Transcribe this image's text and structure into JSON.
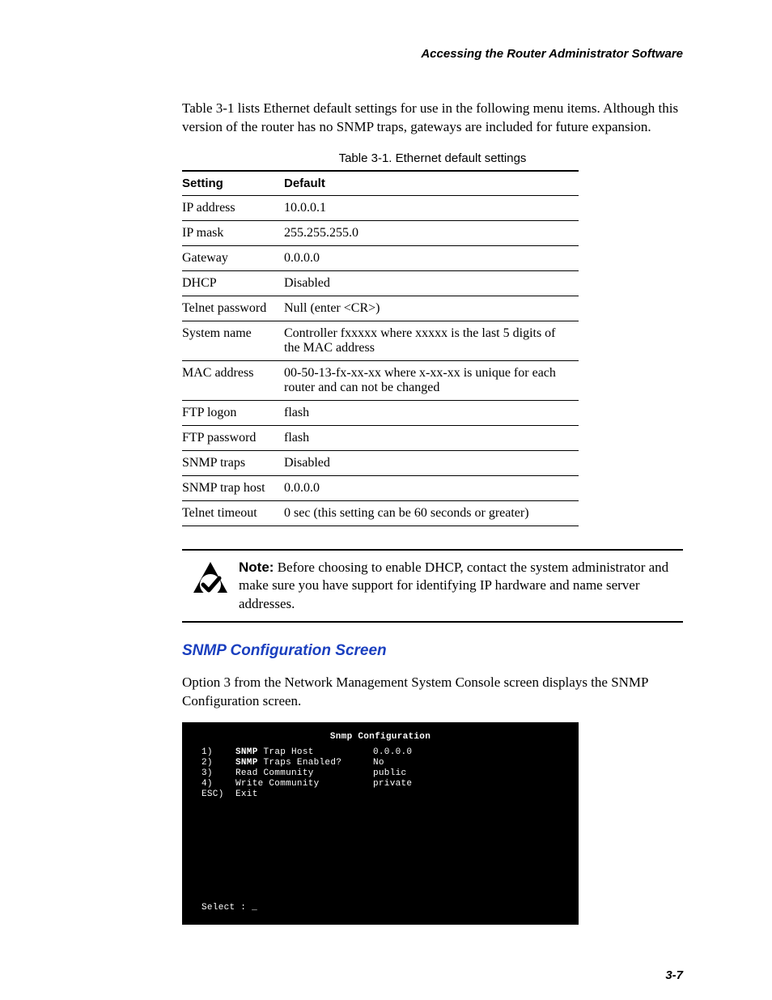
{
  "header": {
    "running_title": "Accessing the Router Administrator Software"
  },
  "intro": "Table 3-1 lists Ethernet default settings for use in the following menu items. Although this version of the router has no SNMP traps, gateways are included for future expansion.",
  "table": {
    "caption": "Table 3-1. Ethernet default settings",
    "columns": [
      "Setting",
      "Default"
    ],
    "rows": [
      {
        "setting": "IP address",
        "default": "10.0.0.1"
      },
      {
        "setting": "IP mask",
        "default": "255.255.255.0"
      },
      {
        "setting": "Gateway",
        "default": "0.0.0.0"
      },
      {
        "setting": "DHCP",
        "default": "Disabled"
      },
      {
        "setting": "Telnet password",
        "default": "Null (enter <CR>)"
      },
      {
        "setting": "System name",
        "default": "Controller fxxxxx where xxxxx is the last 5 digits of the MAC address"
      },
      {
        "setting": "MAC address",
        "default": "00-50-13-fx-xx-xx where x-xx-xx is unique for each router and can not be changed"
      },
      {
        "setting": "FTP logon",
        "default": "flash"
      },
      {
        "setting": "FTP password",
        "default": "flash"
      },
      {
        "setting": "SNMP traps",
        "default": "Disabled"
      },
      {
        "setting": "SNMP trap host",
        "default": "0.0.0.0"
      },
      {
        "setting": "Telnet timeout",
        "default": "0 sec (this setting can be 60 seconds or greater)"
      }
    ]
  },
  "note": {
    "label": "Note:",
    "text": " Before choosing to enable DHCP, contact the system administrator and make sure you have support for identifying IP hardware and name server addresses."
  },
  "section": {
    "heading": "SNMP Configuration Screen",
    "paragraph": "Option 3 from the Network Management System Console screen displays the SNMP Configuration screen."
  },
  "terminal": {
    "title": "Snmp Configuration",
    "lines": [
      {
        "key": "1)",
        "label": "SNMP Trap Host",
        "value": "0.0.0.0"
      },
      {
        "key": "2)",
        "label": "SNMP Traps Enabled?",
        "value": "No"
      },
      {
        "key": "3)",
        "label": "Read Community",
        "value": "public"
      },
      {
        "key": "4)",
        "label": "Write Community",
        "value": "private"
      },
      {
        "key": "ESC)",
        "label": "Exit",
        "value": ""
      }
    ],
    "prompt": "Select : _"
  },
  "page_number": "3-7"
}
